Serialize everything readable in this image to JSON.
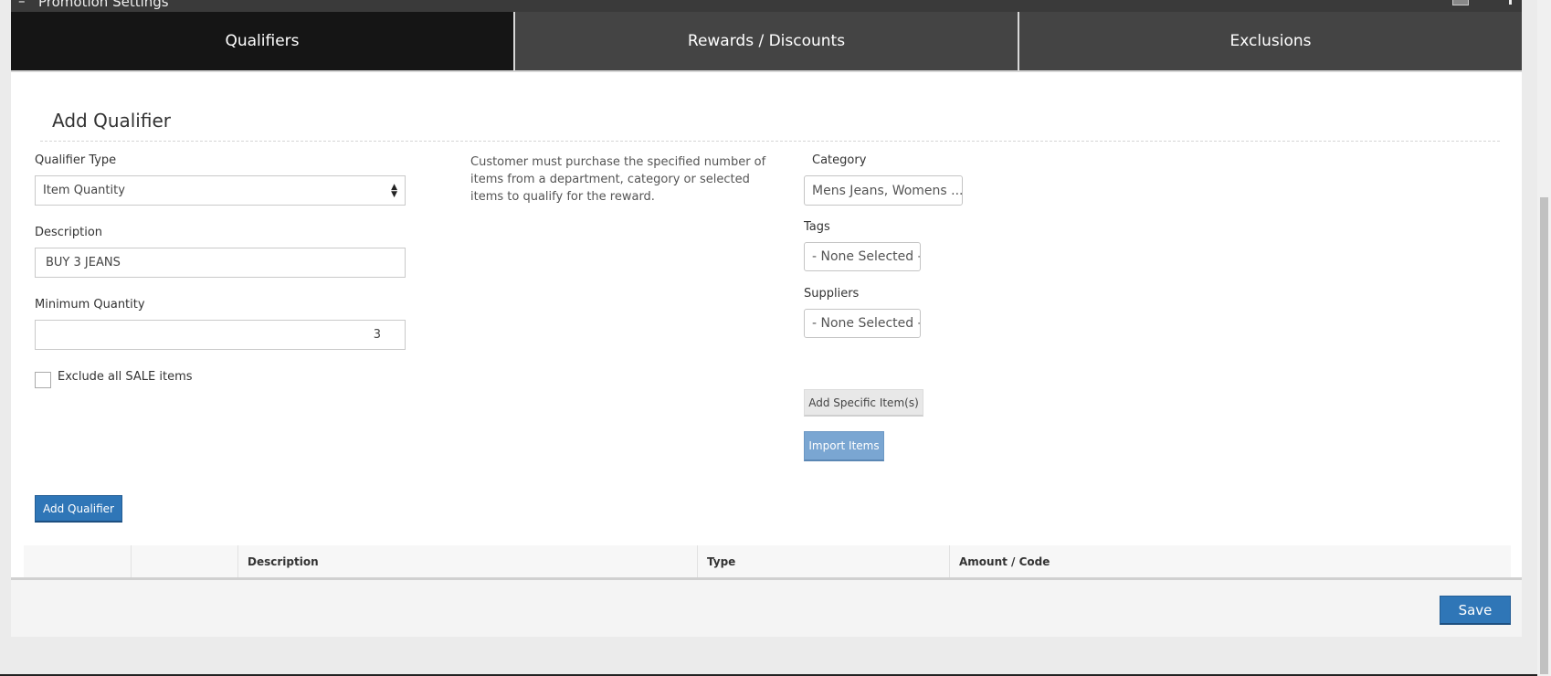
{
  "panel": {
    "title": "Promotion Settings"
  },
  "tabs": [
    {
      "label": "Qualifiers",
      "active": true
    },
    {
      "label": "Rewards / Discounts",
      "active": false
    },
    {
      "label": "Exclusions",
      "active": false
    }
  ],
  "form": {
    "section_title": "Add Qualifier",
    "qualifier_type": {
      "label": "Qualifier Type",
      "value": "Item Quantity"
    },
    "description": {
      "label": "Description",
      "value": "BUY 3 JEANS"
    },
    "minimum_quantity": {
      "label": "Minimum Quantity",
      "value": "3"
    },
    "exclude_sale": {
      "label": "Exclude all SALE items",
      "checked": false
    },
    "help_text": "Customer must purchase the specified number of items from a department, category or selected items to qualify for the reward.",
    "category": {
      "label": "Category",
      "value": "Mens Jeans, Womens ..."
    },
    "tags": {
      "label": "Tags",
      "value": "- None Selected -"
    },
    "suppliers": {
      "label": "Suppliers",
      "value": "- None Selected -"
    },
    "add_specific_label": "Add Specific Item(s)",
    "import_label": "Import Items",
    "add_qualifier_label": "Add Qualifier"
  },
  "table": {
    "columns": [
      "",
      "",
      "Description",
      "Type",
      "Amount / Code"
    ]
  },
  "footer": {
    "save_label": "Save"
  },
  "colors": {
    "primary": "#2f76b7",
    "active_tab": "#151515",
    "tab": "#444444",
    "import": "#7aa6d2"
  }
}
